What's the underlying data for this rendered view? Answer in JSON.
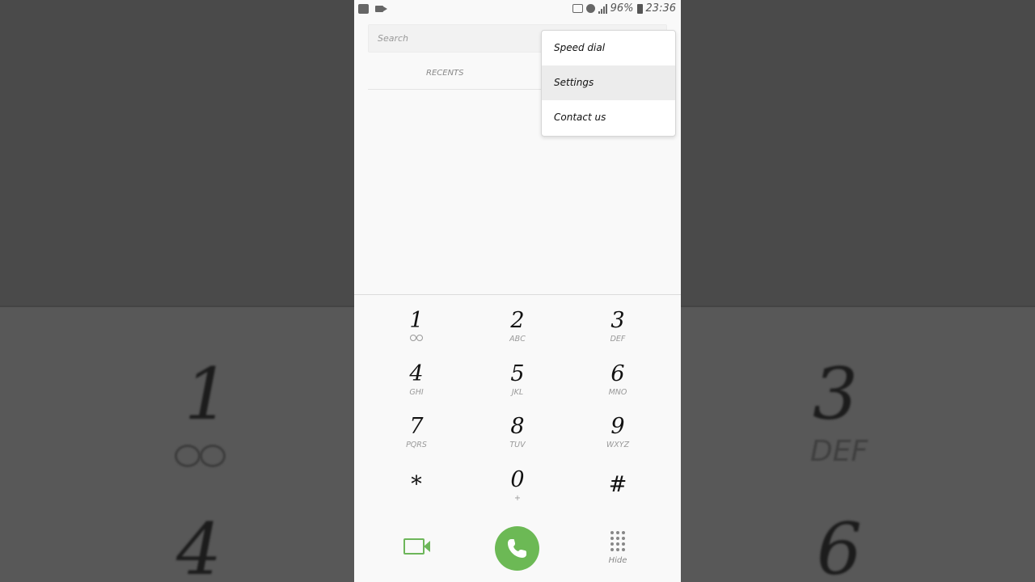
{
  "status_bar": {
    "battery": "96%",
    "time": "23:36"
  },
  "search": {
    "placeholder": "Search"
  },
  "tabs": {
    "recents": "RECENTS"
  },
  "menu": {
    "items": [
      "Speed dial",
      "Settings",
      "Contact us"
    ],
    "highlighted": "Settings"
  },
  "keypad": [
    {
      "digit": "1",
      "letters": "voicemail-icon"
    },
    {
      "digit": "2",
      "letters": "ABC"
    },
    {
      "digit": "3",
      "letters": "DEF"
    },
    {
      "digit": "4",
      "letters": "GHI"
    },
    {
      "digit": "5",
      "letters": "JKL"
    },
    {
      "digit": "6",
      "letters": "MNO"
    },
    {
      "digit": "7",
      "letters": "PQRS"
    },
    {
      "digit": "8",
      "letters": "TUV"
    },
    {
      "digit": "9",
      "letters": "WXYZ"
    },
    {
      "digit": "*",
      "letters": ""
    },
    {
      "digit": "0",
      "letters": "+"
    },
    {
      "digit": "#",
      "letters": ""
    }
  ],
  "bottom": {
    "hide_label": "Hide"
  },
  "colors": {
    "call_green": "#6cb955",
    "video_green": "#6db65a"
  },
  "background_zoom": {
    "digits": [
      "1",
      "3",
      "4",
      "6"
    ],
    "letters": [
      "DEF"
    ]
  }
}
